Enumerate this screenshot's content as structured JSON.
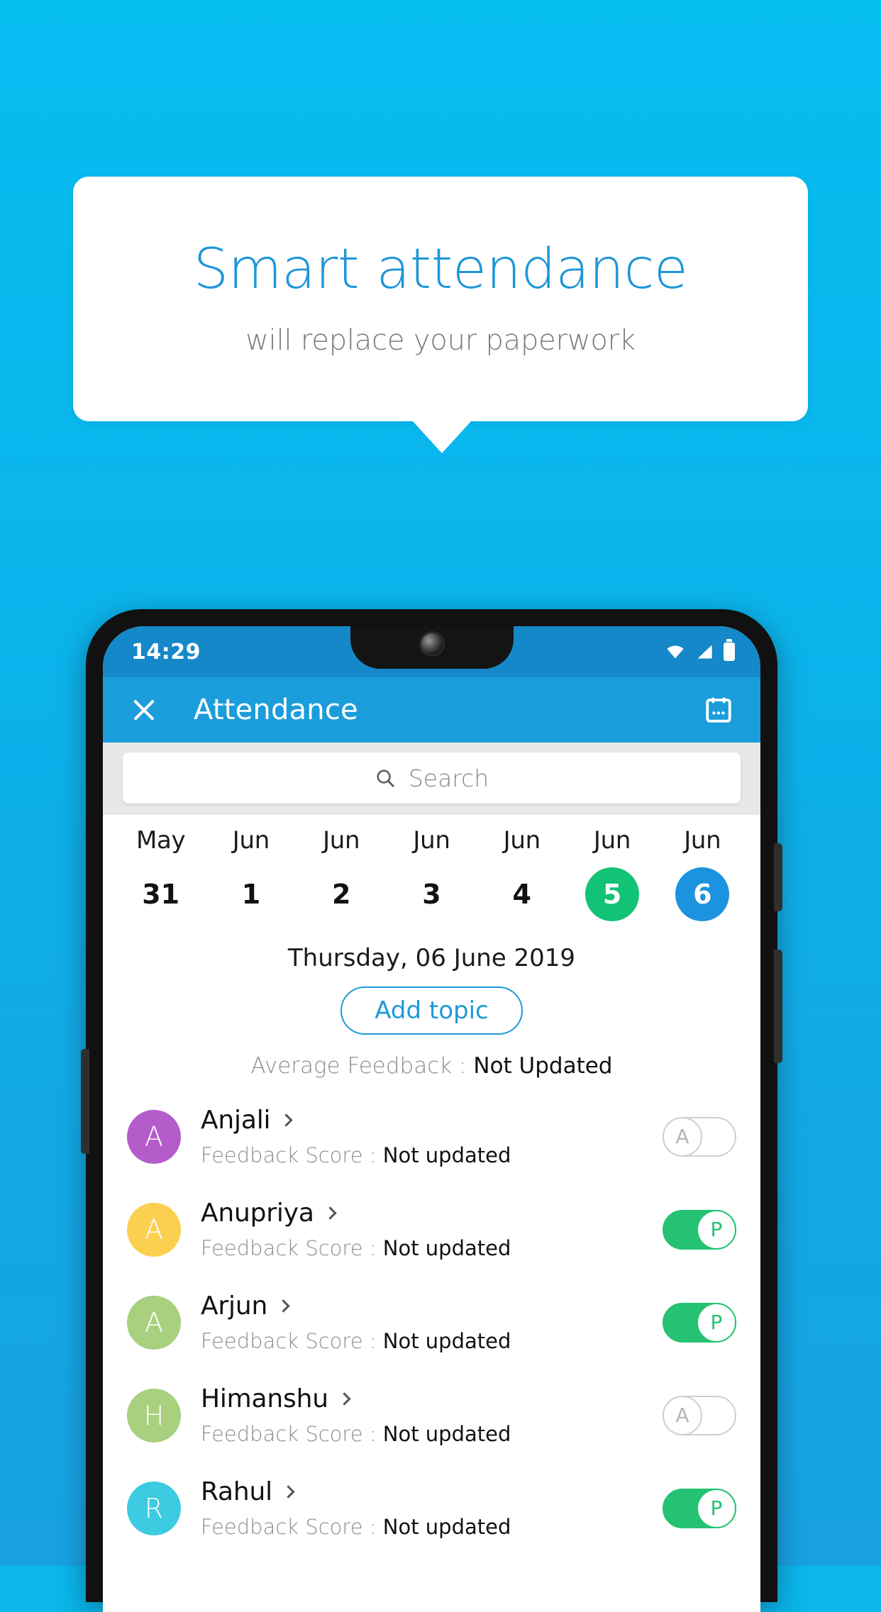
{
  "promo": {
    "title": "Smart attendance",
    "subtitle": "will replace your paperwork",
    "accent_color": "#1e96d8",
    "background_color": "#0ab6ea"
  },
  "phone": {
    "status_bar": {
      "time": "14:29",
      "icons": [
        "wifi-icon",
        "signal-icon",
        "battery-icon"
      ]
    },
    "app_bar": {
      "close_label": "close-icon",
      "title": "Attendance",
      "calendar_label": "calendar-icon",
      "color": "#1b9ddb"
    },
    "search": {
      "placeholder": "Search",
      "value": "",
      "icon": "search-icon"
    },
    "date_strip": [
      {
        "month": "May",
        "day": "31",
        "state": "normal"
      },
      {
        "month": "Jun",
        "day": "1",
        "state": "normal"
      },
      {
        "month": "Jun",
        "day": "2",
        "state": "normal"
      },
      {
        "month": "Jun",
        "day": "3",
        "state": "normal"
      },
      {
        "month": "Jun",
        "day": "4",
        "state": "normal"
      },
      {
        "month": "Jun",
        "day": "5",
        "state": "green"
      },
      {
        "month": "Jun",
        "day": "6",
        "state": "blue"
      }
    ],
    "selected_date": "Thursday, 06 June 2019",
    "add_topic_label": "Add topic",
    "average_feedback": {
      "label": "Average Feedback : ",
      "value": "Not Updated"
    },
    "feedback_label": "Feedback Score : ",
    "students": [
      {
        "name": "Anjali",
        "initial": "A",
        "color": "#b55ccb",
        "feedback": "Not updated",
        "status": "A",
        "present": false
      },
      {
        "name": "Anupriya",
        "initial": "A",
        "color": "#fbcf4f",
        "feedback": "Not updated",
        "status": "P",
        "present": true
      },
      {
        "name": "Arjun",
        "initial": "A",
        "color": "#a8d07e",
        "feedback": "Not updated",
        "status": "P",
        "present": true
      },
      {
        "name": "Himanshu",
        "initial": "H",
        "color": "#a8d07e",
        "feedback": "Not updated",
        "status": "A",
        "present": false
      },
      {
        "name": "Rahul",
        "initial": "R",
        "color": "#3ccbe0",
        "feedback": "Not updated",
        "status": "P",
        "present": true
      }
    ],
    "colors": {
      "selected_green": "#12c275",
      "selected_blue": "#1b93de",
      "present_green": "#25c274",
      "accent": "#1f9ad6"
    }
  }
}
